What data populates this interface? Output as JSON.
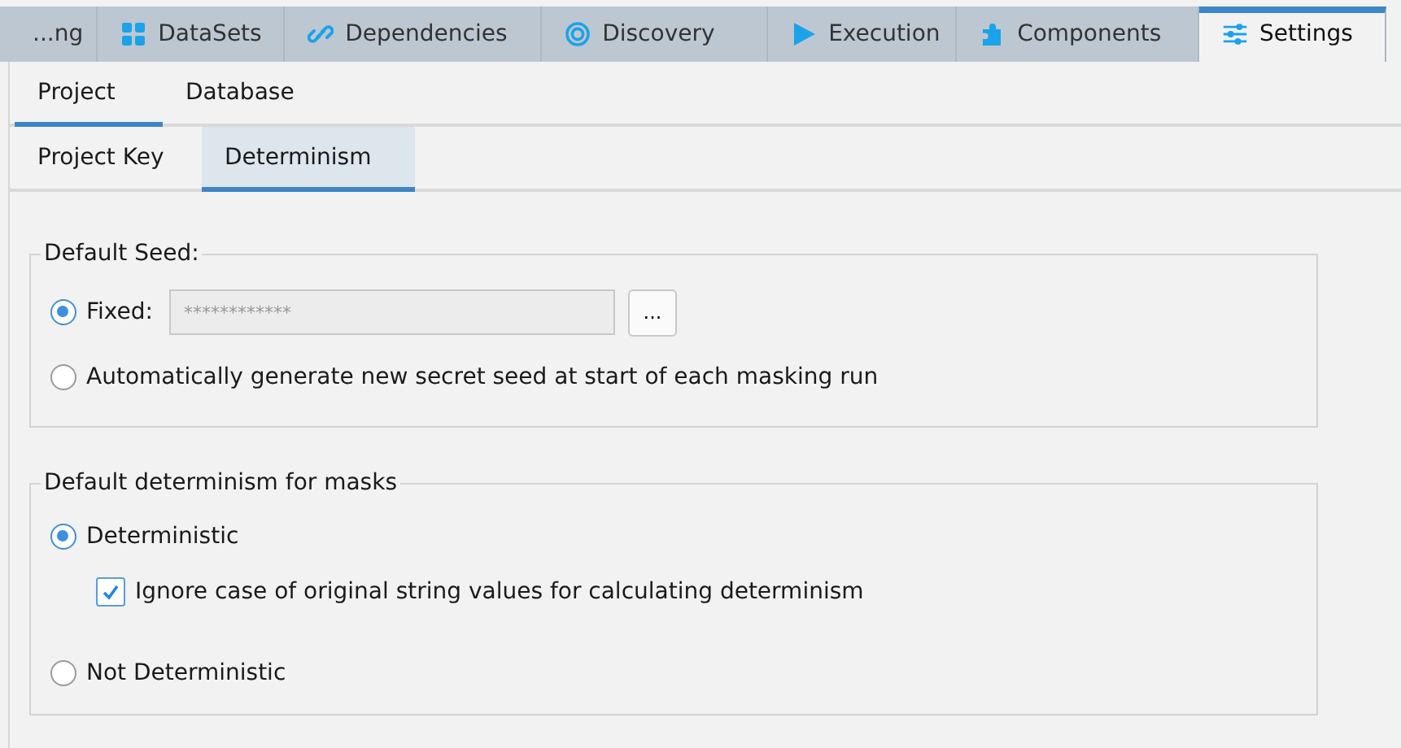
{
  "main_tabs": [
    {
      "label": "...ng",
      "selected": false
    },
    {
      "label": "DataSets",
      "selected": false
    },
    {
      "label": "Dependencies",
      "selected": false
    },
    {
      "label": "Discovery",
      "selected": false
    },
    {
      "label": "Execution",
      "selected": false
    },
    {
      "label": "Components",
      "selected": false
    },
    {
      "label": "Settings",
      "selected": true
    }
  ],
  "sub_tabs": [
    {
      "label": "Project",
      "selected": true
    },
    {
      "label": "Database",
      "selected": false
    }
  ],
  "section_tabs": [
    {
      "label": "Project Key",
      "selected": false
    },
    {
      "label": "Determinism",
      "selected": true
    }
  ],
  "default_seed": {
    "legend": "Default Seed:",
    "options": [
      {
        "label": "Fixed:",
        "selected": true,
        "field": {
          "value": "************",
          "disabled": true
        },
        "button": "..."
      },
      {
        "label": "Automatically generate new secret seed at start of each masking run",
        "selected": false
      }
    ]
  },
  "default_determinism": {
    "legend": "Default determinism for masks",
    "options": [
      {
        "label": "Deterministic",
        "selected": true,
        "checkbox": {
          "label": "Ignore case of original string values for calculating determinism",
          "checked": true
        }
      },
      {
        "label": "Not Deterministic",
        "selected": false
      }
    ]
  }
}
